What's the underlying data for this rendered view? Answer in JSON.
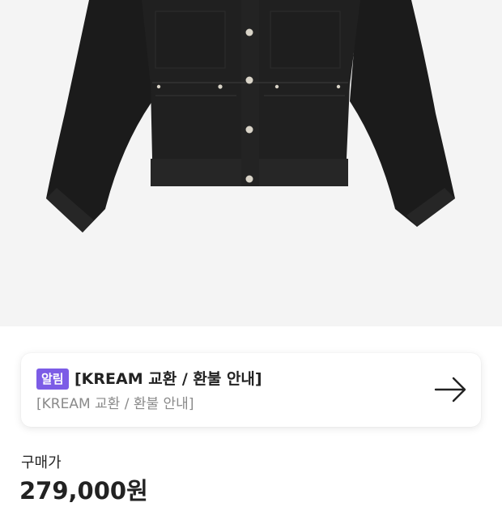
{
  "product": {
    "image_icon": "black-denim-jacket-photo"
  },
  "notice": {
    "badge": "알림",
    "title": "[KREAM 교환 / 환불 안내]",
    "subtitle": "[KREAM 교환 / 환불 안내]",
    "arrow_icon": "arrow-right-icon",
    "badge_color": "#7C5CE6"
  },
  "price": {
    "label": "구매가",
    "value": "279,000원"
  }
}
